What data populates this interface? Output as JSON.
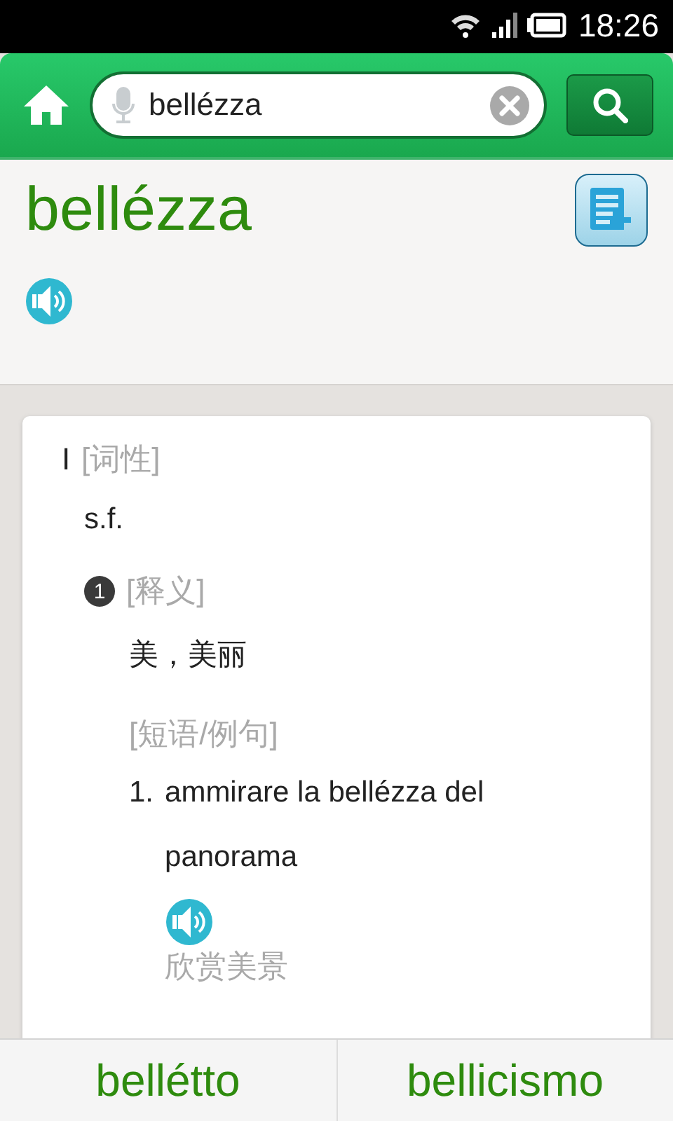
{
  "status_bar": {
    "time": "18:26"
  },
  "search": {
    "value": "bellézza"
  },
  "entry": {
    "headword": "bellézza",
    "senses": [
      {
        "numeral": "I",
        "pos_label": "[词性]",
        "pos": "s.f.",
        "definitions": [
          {
            "number": "1",
            "label": "[释义]",
            "meaning": "美，美丽",
            "examples_label": "[短语/例句]",
            "examples": [
              {
                "number": "1.",
                "text": "ammirare la bellézza del panorama",
                "translation": "欣赏美景"
              }
            ]
          }
        ]
      }
    ]
  },
  "nav": [
    "bellétto",
    "bellicismo"
  ]
}
